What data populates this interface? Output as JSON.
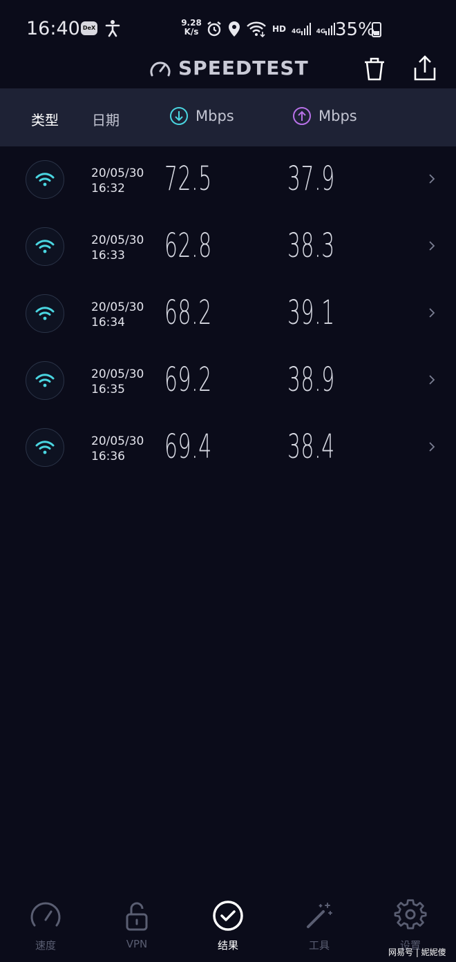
{
  "status_bar": {
    "time": "16:40",
    "dex": "DeX",
    "net_speed_value": "9.28",
    "net_speed_unit": "K/s",
    "hd": "HD",
    "sig1": "4G",
    "sig2": "4G",
    "battery": "35%"
  },
  "app_bar": {
    "title": "SPEEDTEST"
  },
  "table_header": {
    "type": "类型",
    "date": "日期",
    "download_unit": "Mbps",
    "upload_unit": "Mbps"
  },
  "colors": {
    "accent_download": "#4ad6e1",
    "accent_upload": "#b871e8",
    "background": "#0b0c1a",
    "header_bg": "#1e2235"
  },
  "results": [
    {
      "date": "20/05/30",
      "time": "16:32",
      "download": "72.5",
      "upload": "37.9"
    },
    {
      "date": "20/05/30",
      "time": "16:33",
      "download": "62.8",
      "upload": "38.3"
    },
    {
      "date": "20/05/30",
      "time": "16:34",
      "download": "68.2",
      "upload": "39.1"
    },
    {
      "date": "20/05/30",
      "time": "16:35",
      "download": "69.2",
      "upload": "38.9"
    },
    {
      "date": "20/05/30",
      "time": "16:36",
      "download": "69.4",
      "upload": "38.4"
    }
  ],
  "nav": {
    "speed": "速度",
    "vpn": "VPN",
    "results": "结果",
    "tools": "工具",
    "settings": "设置"
  },
  "watermark": "网易号 | 妮妮傻"
}
